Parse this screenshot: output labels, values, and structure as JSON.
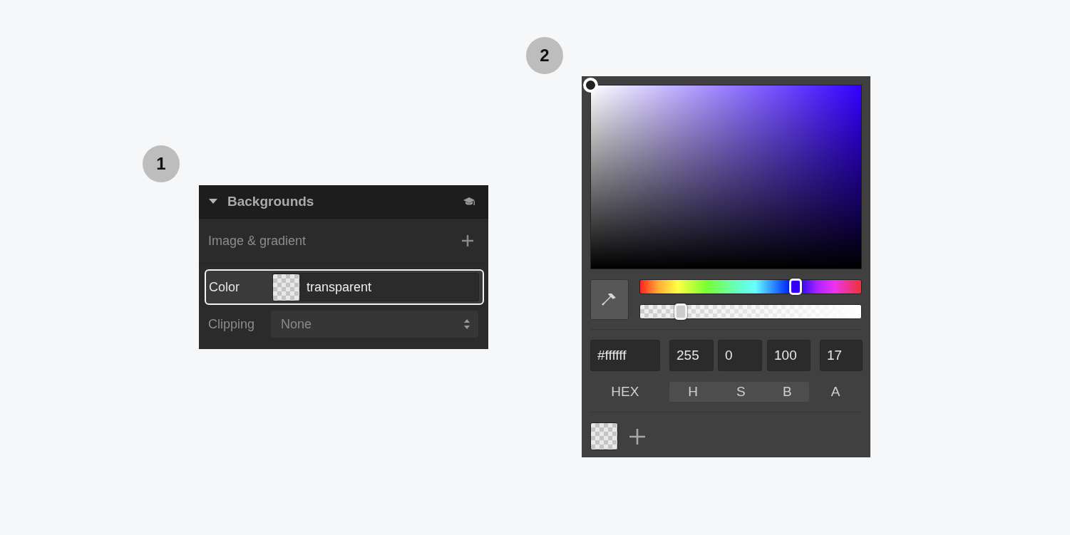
{
  "callouts": [
    "1",
    "2"
  ],
  "backgrounds_panel": {
    "title": "Backgrounds",
    "expanded": true,
    "image_gradient_label": "Image & gradient",
    "color_row": {
      "label": "Color",
      "value": "transparent",
      "focused": true
    },
    "clipping_row": {
      "label": "Clipping",
      "value": "None"
    }
  },
  "color_picker": {
    "hue_slider": {
      "level": 0.7
    },
    "alpha_slider": {
      "level": 0.18
    },
    "fields": [
      {
        "kind": "hex",
        "value": "#ffffff"
      },
      {
        "kind": "h",
        "value": "255"
      },
      {
        "kind": "s",
        "value": "0"
      },
      {
        "kind": "b",
        "value": "100"
      },
      {
        "kind": "a",
        "value": "17"
      }
    ],
    "labels": [
      {
        "text": "HEX",
        "selected": false
      },
      {
        "text": "H",
        "selected": true
      },
      {
        "text": "S",
        "selected": true
      },
      {
        "text": "B",
        "selected": true
      },
      {
        "text": "A",
        "selected": false
      }
    ]
  }
}
